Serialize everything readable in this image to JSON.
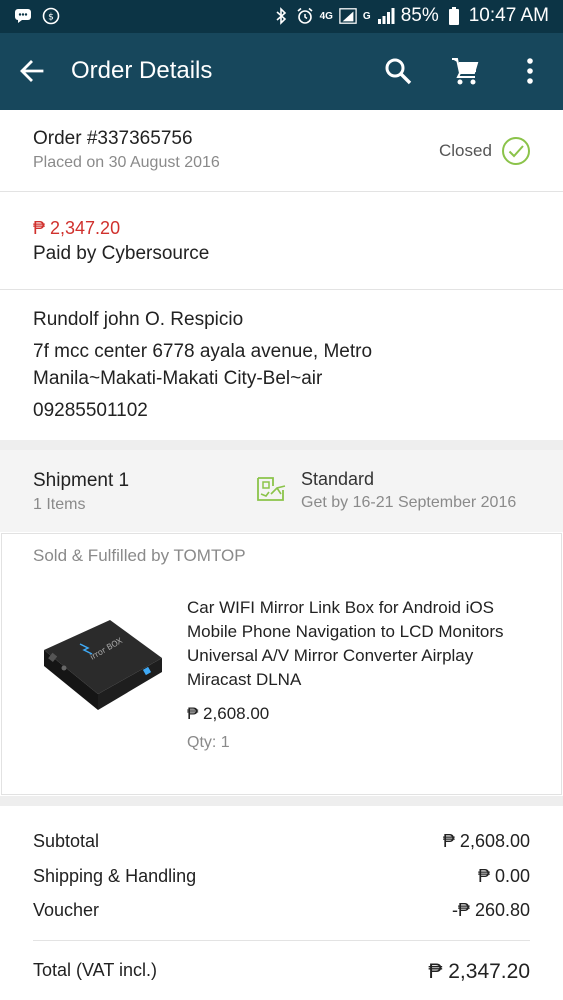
{
  "statusbar": {
    "signal_label_4g": "4G",
    "signal_label_g": "G",
    "battery": "85%",
    "time": "10:47 AM"
  },
  "appbar": {
    "title": "Order Details"
  },
  "order": {
    "number": "Order #337365756",
    "placed": "Placed on 30 August 2016",
    "status": "Closed"
  },
  "payment": {
    "amount": "₱ 2,347.20",
    "method": "Paid by Cybersource"
  },
  "address": {
    "name": "Rundolf john O. Respicio",
    "line1": "7f mcc center 6778 ayala avenue, Metro",
    "line2": "Manila~Makati-Makati City-Bel~air",
    "phone": "09285501102"
  },
  "shipment": {
    "title": "Shipment 1",
    "items": "1 Items",
    "type": "Standard",
    "delivery": "Get by 16-21 September 2016"
  },
  "product": {
    "seller": "Sold & Fulfilled by TOMTOP",
    "name": "Car WIFI Mirror Link Box for Android iOS Mobile Phone Navigation to LCD Monitors Universal A/V Mirror Converter Airplay Miracast DLNA",
    "price": "₱ 2,608.00",
    "qty": "Qty: 1"
  },
  "summary": {
    "rows": [
      {
        "label": "Subtotal",
        "value": "₱ 2,608.00"
      },
      {
        "label": "Shipping & Handling",
        "value": "₱ 0.00"
      },
      {
        "label": "Voucher",
        "value": "-₱ 260.80"
      }
    ],
    "total_label": "Total (VAT incl.)",
    "total_value": "₱ 2,347.20"
  },
  "colors": {
    "statusbar": "#0c3445",
    "appbar": "#17475c",
    "accent_red": "#d0312d",
    "check_green": "#8bc34a"
  }
}
